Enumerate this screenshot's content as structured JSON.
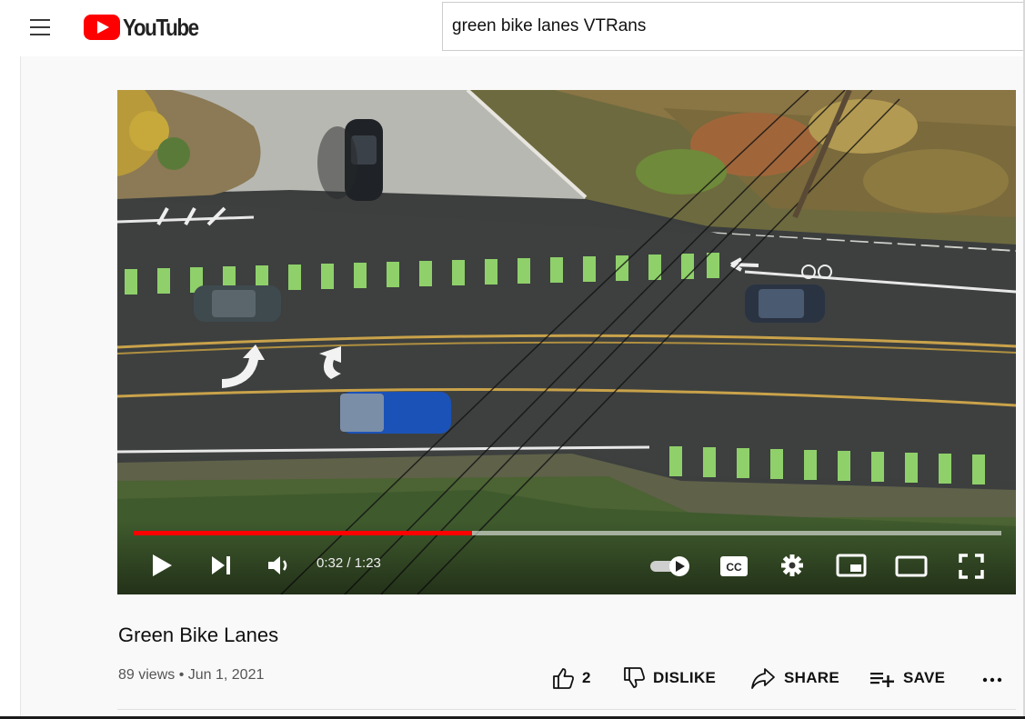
{
  "header": {
    "logo_text": "YouTube",
    "search_value": "green bike lanes VTRans"
  },
  "player": {
    "time_display": "0:32 / 1:23",
    "progress_fraction": 0.39,
    "progress_color": "#ff0000"
  },
  "video": {
    "title": "Green Bike Lanes",
    "meta": "89 views • Jun 1, 2021",
    "actions": {
      "like_count": "2",
      "dislike_label": "DISLIKE",
      "share_label": "SHARE",
      "save_label": "SAVE"
    }
  },
  "icons": [
    "menu-icon",
    "youtube-logo-icon",
    "play-icon",
    "next-icon",
    "volume-icon",
    "autoplay-toggle-icon",
    "captions-icon",
    "settings-icon",
    "miniplayer-icon",
    "theater-icon",
    "fullscreen-icon",
    "like-icon",
    "dislike-icon",
    "share-icon",
    "save-icon",
    "more-icon"
  ]
}
